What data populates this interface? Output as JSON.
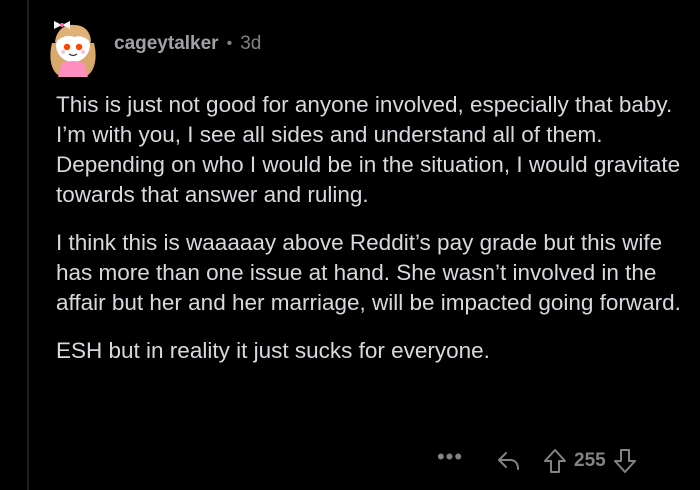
{
  "comment": {
    "username": "cageytalker",
    "separator": "•",
    "age": "3d",
    "paragraphs": [
      "This is just not good for anyone involved, especially that baby.  I’m with you, I see all sides and understand all of them.  Depending on who I would be in the situation, I would gravitate towards that answer and ruling.",
      "I think this is waaaaay above Reddit’s pay grade but this wife has more than one issue at hand.  She wasn’t involved in the affair but her and her marriage, will be impacted going forward.",
      "ESH but in reality it just sucks for everyone."
    ],
    "actions": {
      "more_label": "•••",
      "score": "255"
    }
  },
  "icons": {
    "avatar": "snoo-avatar",
    "reply": "reply-arrow-icon",
    "upvote": "upvote-arrow-icon",
    "downvote": "downvote-arrow-icon"
  },
  "colors": {
    "background": "#000000",
    "text": "#d7dadc",
    "muted": "#818384",
    "username": "#9fa2a5"
  }
}
